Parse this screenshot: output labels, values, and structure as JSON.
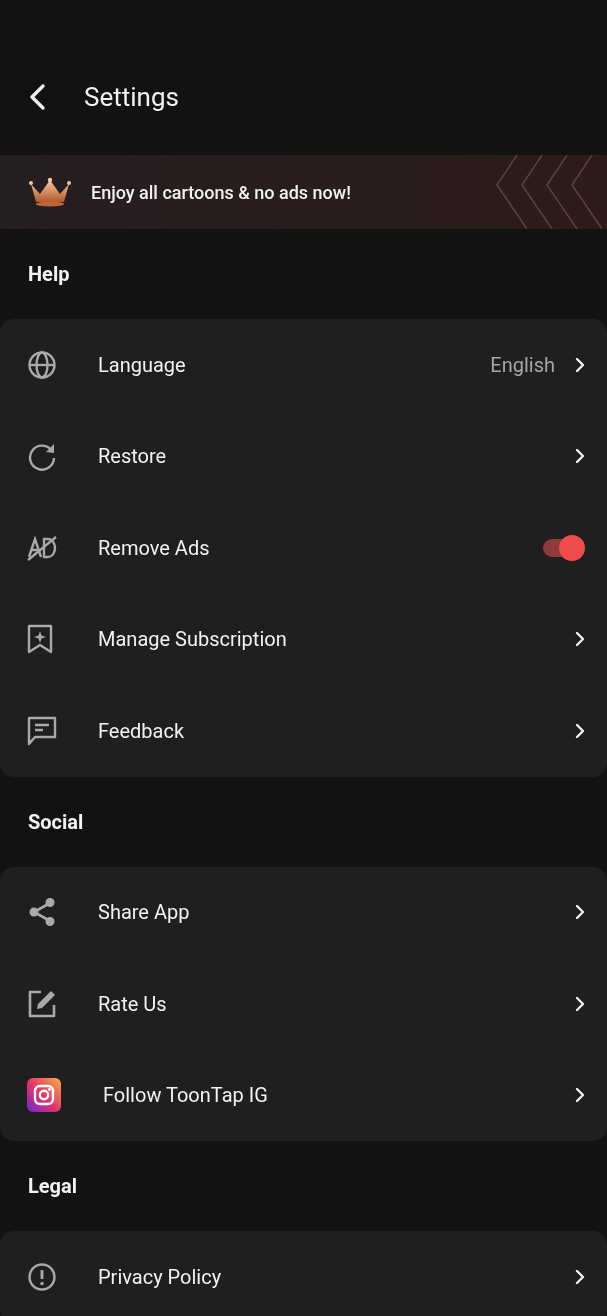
{
  "header": {
    "title": "Settings"
  },
  "banner": {
    "text": "Enjoy all cartoons & no ads now!"
  },
  "sections": [
    {
      "title": "Help",
      "items": [
        {
          "kind": "value",
          "label": "Language",
          "value": "English"
        },
        {
          "kind": "link",
          "label": "Restore"
        },
        {
          "kind": "toggle",
          "label": "Remove Ads",
          "on": true
        },
        {
          "kind": "link",
          "label": "Manage Subscription"
        },
        {
          "kind": "link",
          "label": "Feedback"
        }
      ]
    },
    {
      "title": "Social",
      "items": [
        {
          "kind": "link",
          "label": "Share App"
        },
        {
          "kind": "link",
          "label": "Rate Us"
        },
        {
          "kind": "link",
          "label": "Follow ToonTap IG"
        }
      ]
    },
    {
      "title": "Legal",
      "items": [
        {
          "kind": "link",
          "label": "Privacy Policy"
        }
      ]
    }
  ]
}
